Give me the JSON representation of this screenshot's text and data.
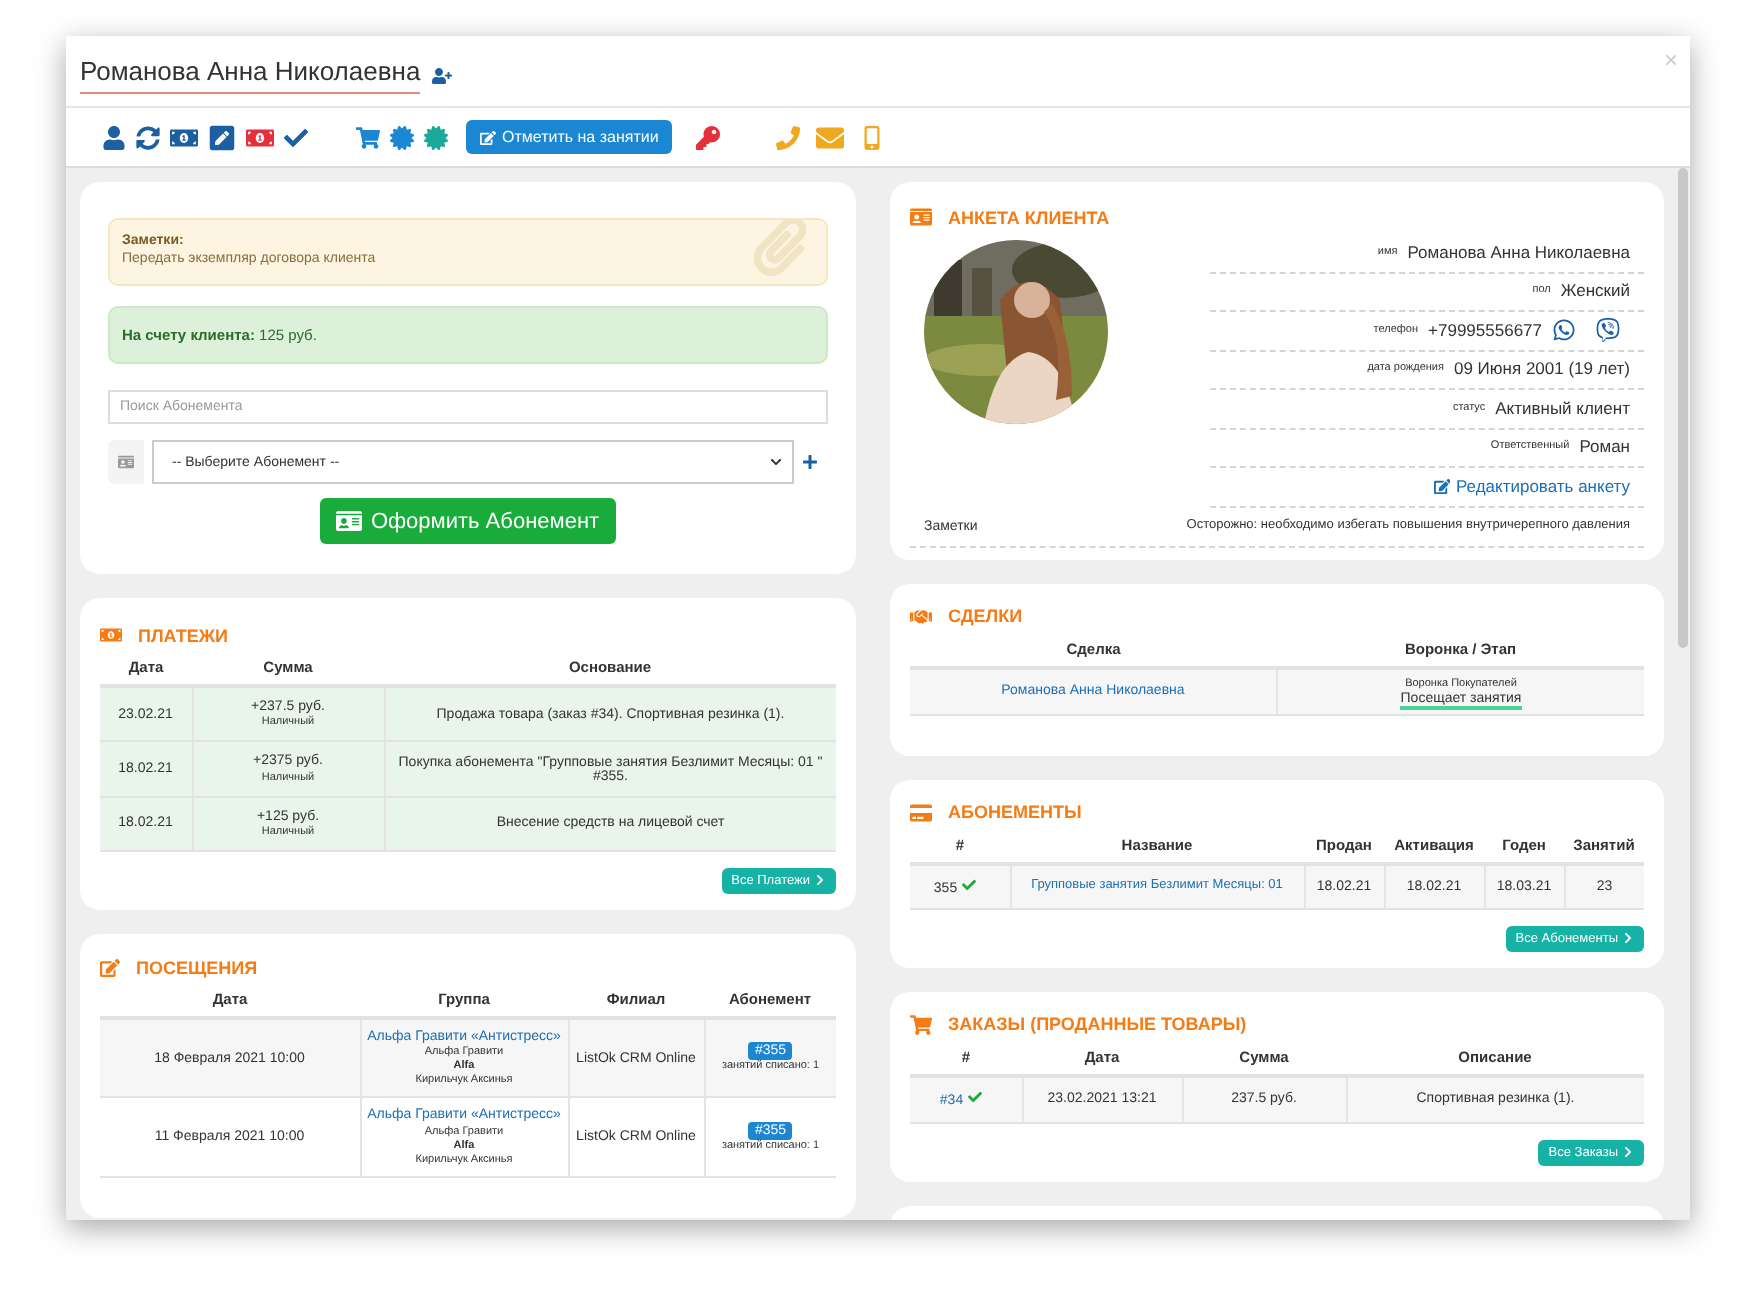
{
  "window": {
    "title": "Романова Анна Николаевна",
    "close": "×"
  },
  "toolbar": {
    "mark_button": "Отметить на занятии"
  },
  "notes_alert": {
    "title": "Заметки:",
    "text": "Передать экземпляр договора клиента"
  },
  "balance_alert": {
    "text": "**На счету клиента:** 125 руб."
  },
  "subscription_search": {
    "placeholder": "Поиск Абонемента"
  },
  "subscription_select": {
    "value": "-- Выберите Абонемент --"
  },
  "issue_button": "Оформить Абонемент",
  "payments": {
    "title": "ПЛАТЕЖИ",
    "columns": [
      "Дата",
      "Сумма",
      "Основание"
    ],
    "rows": [
      {
        "date": "23.02.21",
        "amount": "+237.5 руб.",
        "method": "Наличный",
        "basis": "Продажа товара (заказ #34). Спортивная резинка (1)."
      },
      {
        "date": "18.02.21",
        "amount": "+2375 руб.",
        "method": "Наличный",
        "basis": "Покупка абонемента \"Групповые занятия Безлимит Месяцы: 01 \" #355."
      },
      {
        "date": "18.02.21",
        "amount": "+125 руб.",
        "method": "Наличный",
        "basis": "Внесение средств на лицевой счет"
      }
    ],
    "all_button": "Все Платежи"
  },
  "visits": {
    "title": "ПОСЕЩЕНИЯ",
    "columns": [
      "Дата",
      "Группа",
      "Филиал",
      "Абонемент"
    ],
    "rows": [
      {
        "date": "18 Февраля 2021 10:00",
        "group": "Альфа Гравити «Антистресс»",
        "direction": "Альфа Гравити",
        "code": "Alfa",
        "trainer": "Кирильчук Аксинья",
        "branch": "ListOk CRM Online",
        "subscription": "#355",
        "written_off": "занятий списано: 1"
      },
      {
        "date": "11 Февраля 2021 10:00",
        "group": "Альфа Гравити «Антистресс»",
        "direction": "Альфа Гравити",
        "code": "Alfa",
        "trainer": "Кирильчук Аксинья",
        "branch": "ListOk CRM Online",
        "subscription": "#355",
        "written_off": "занятий списано: 1"
      }
    ]
  },
  "profile": {
    "title": "АНКЕТА КЛИЕНТА",
    "fields": [
      {
        "kind": "text",
        "label": "имя",
        "value": "Романова Анна Николаевна"
      },
      {
        "kind": "text",
        "label": "пол",
        "value": "Женский"
      },
      {
        "kind": "phone",
        "label": "телефон",
        "value": "+79995556677"
      },
      {
        "kind": "text",
        "label": "дата рождения",
        "value": "09 Июня 2001 (19 лет)"
      },
      {
        "kind": "text",
        "label": "статус",
        "value": "Активный клиент"
      },
      {
        "kind": "text",
        "label": "Ответственный",
        "value": "Роман"
      }
    ],
    "edit_link": "Редактировать анкету",
    "notes": {
      "label": "Заметки",
      "value": "Осторожно: необходимо избегать повышения внутричерепного давления"
    }
  },
  "deals": {
    "title": "СДЕЛКИ",
    "columns": [
      "Сделка",
      "Воронка / Этап"
    ],
    "rows": [
      {
        "deal": "Романова Анна Николаевна",
        "funnel": "Воронка Покупателей",
        "stage": "Посещает занятия"
      }
    ]
  },
  "subscriptions": {
    "title": "АБОНЕМЕНТЫ",
    "columns": [
      "#",
      "Название",
      "Продан",
      "Активация",
      "Годен",
      "Занятий"
    ],
    "rows": [
      {
        "number": "355",
        "active": true,
        "name": "Групповые занятия Безлимит Месяцы: 01",
        "sold": "18.02.21",
        "activation": "18.02.21",
        "valid": "18.03.21",
        "sessions": "23"
      }
    ],
    "all_button": "Все Абонементы"
  },
  "orders": {
    "title": "ЗАКАЗЫ (ПРОДАННЫЕ ТОВАРЫ)",
    "columns": [
      "#",
      "Дата",
      "Сумма",
      "Описание"
    ],
    "rows": [
      {
        "number": "#34",
        "paid": true,
        "date": "23.02.2021 13:21",
        "amount": "237.5 руб.",
        "description": "Спортивная резинка (1)."
      }
    ],
    "all_button": "Все Заказы"
  }
}
